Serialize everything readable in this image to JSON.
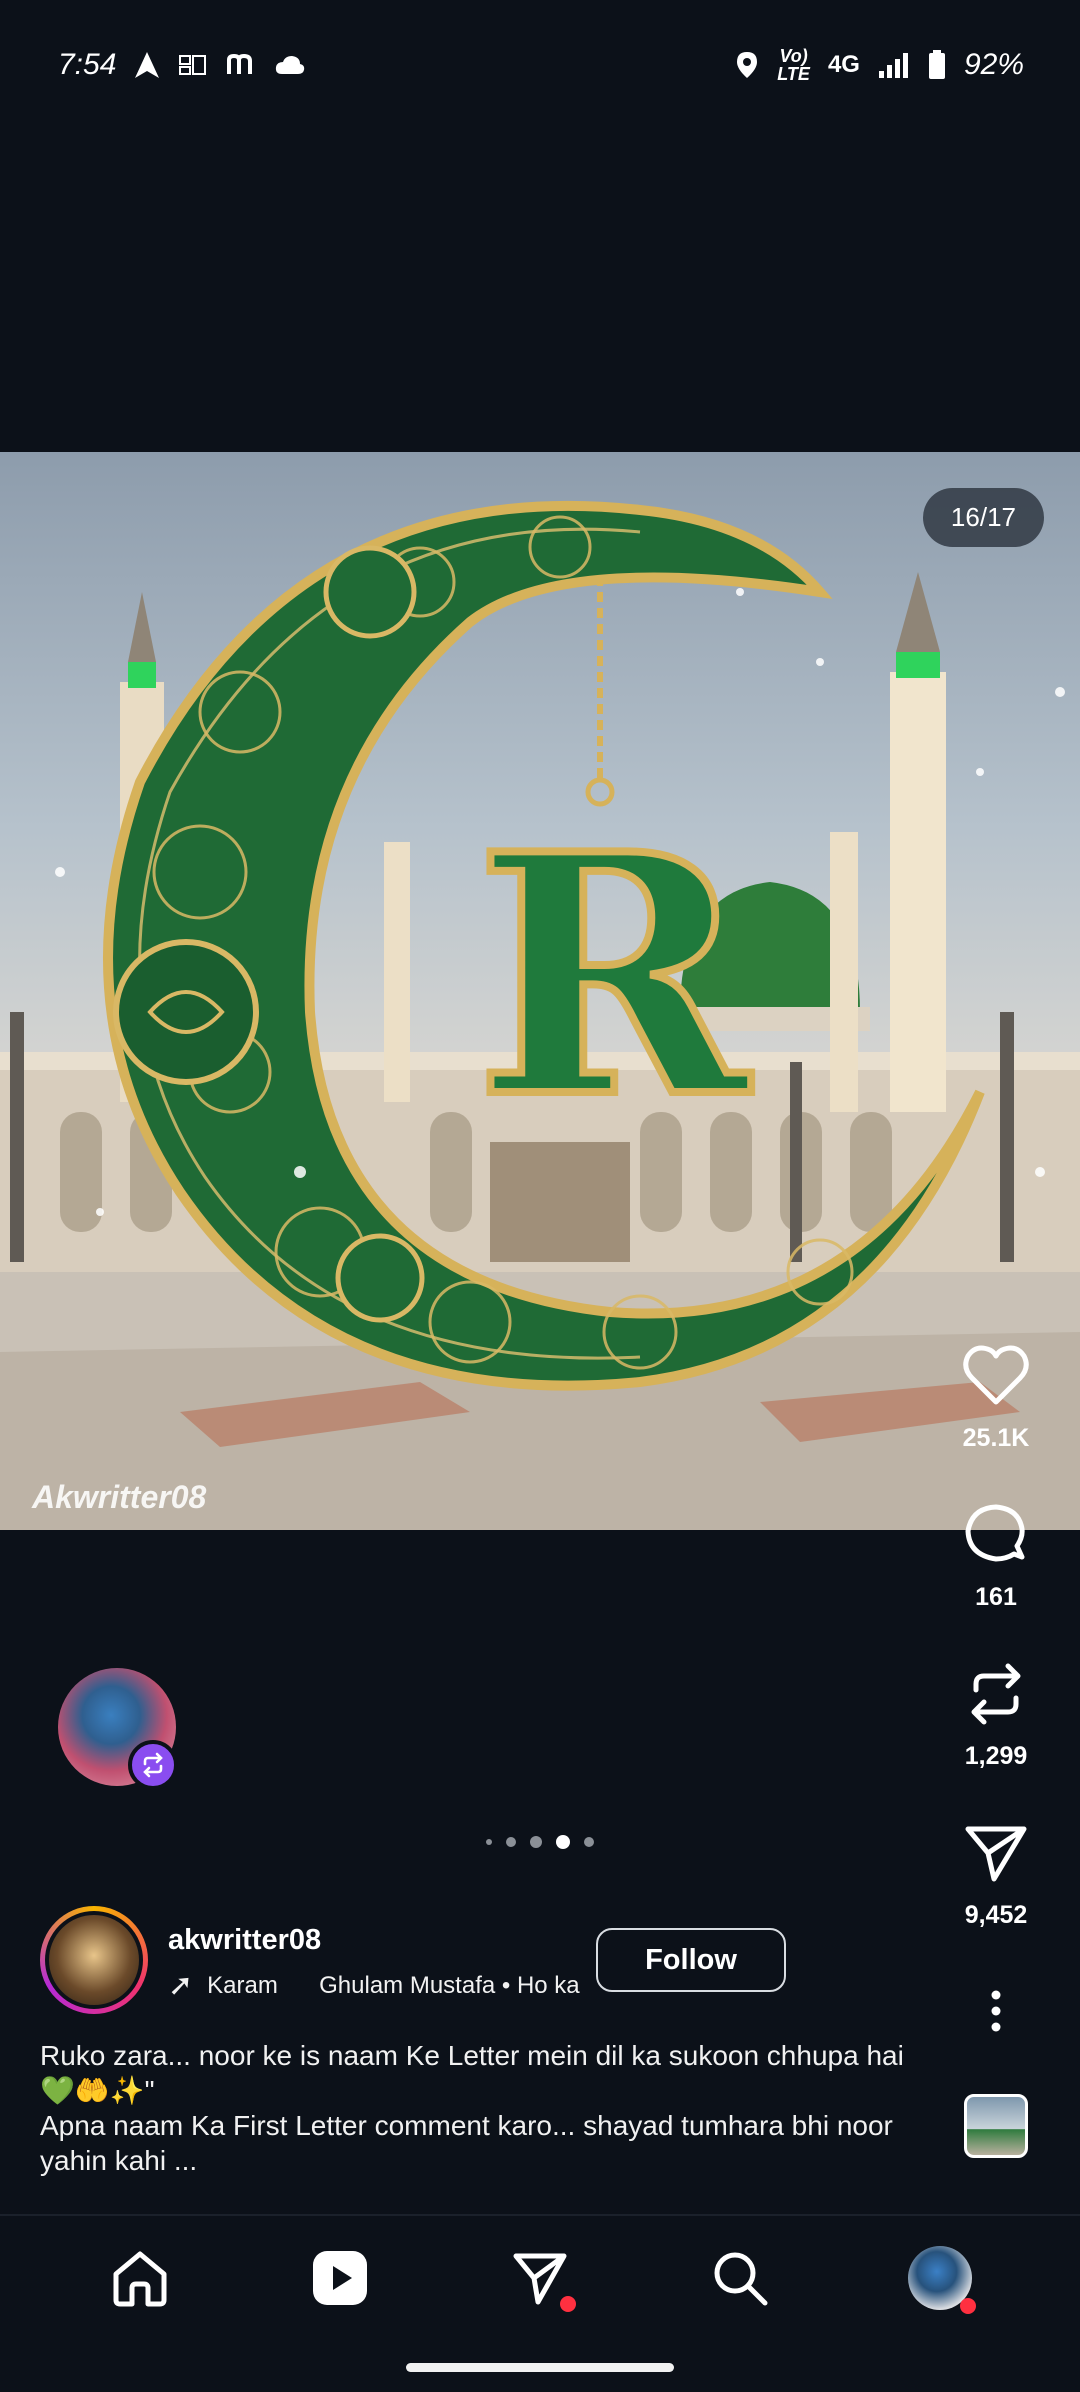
{
  "status_bar": {
    "time": "7:54",
    "battery": "92%",
    "network": "4G",
    "volte_top": "Vo)",
    "volte_bottom": "LTE"
  },
  "media": {
    "page_indicator": "16/17",
    "watermark": "Akwritter08",
    "letter": "R",
    "current_slide": 16,
    "total_slides": 17
  },
  "actions": {
    "likes": "25.1K",
    "comments": "161",
    "reposts": "1,299",
    "shares": "9,452"
  },
  "carousel_dots": {
    "count": 5,
    "active_index": 3
  },
  "author": {
    "username": "akwritter08",
    "audio_track_1": "Karam",
    "audio_track_2": "Ghulam Mustafa • Ho ka",
    "follow_label": "Follow"
  },
  "caption": {
    "line1": "Ruko zara... noor ke is naam Ke Letter mein dil ka sukoon chhupa hai 💚🤲✨\"",
    "line2": "Apna naam Ka First Letter comment karo... shayad tumhara bhi noor yahin kahi ..."
  },
  "nav": {
    "items": [
      "home",
      "reels",
      "direct",
      "search",
      "profile"
    ],
    "active": "reels"
  },
  "colors": {
    "background": "#0c1119",
    "accent_red": "#ff3040",
    "remix_purple": "#8a4df0"
  }
}
